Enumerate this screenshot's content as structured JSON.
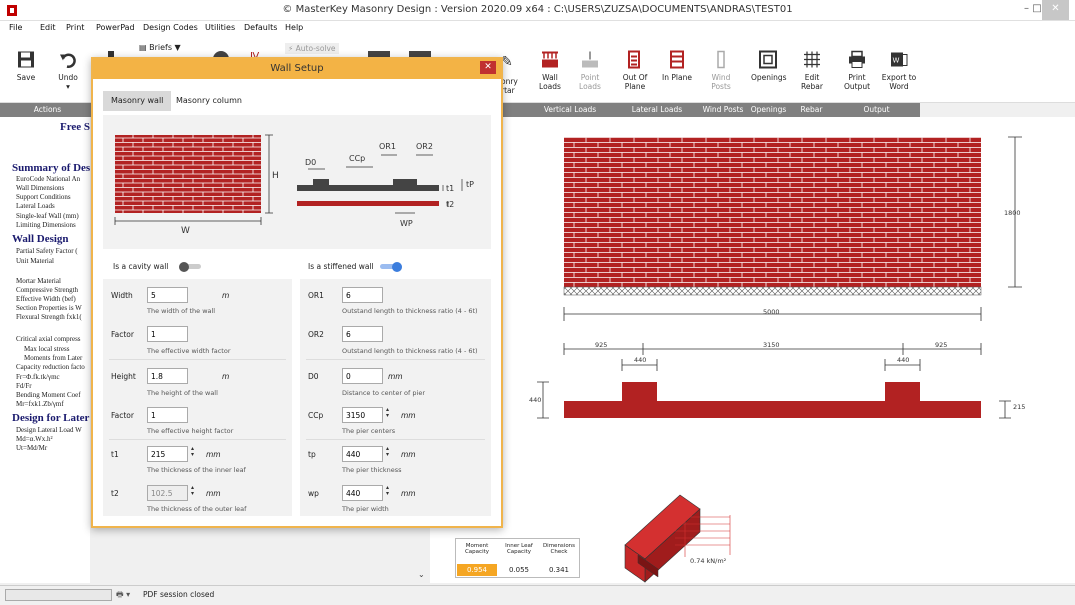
{
  "window": {
    "title": "© MasterKey Masonry Design : Version 2020.09 x64 : C:\\USERS\\ZUZSA\\DOCUMENTS\\ANDRAS\\TEST01"
  },
  "menu": [
    "File",
    "Edit",
    "Print",
    "PowerPad",
    "Design Codes",
    "Utilities",
    "Defaults",
    "Help"
  ],
  "ribbon": {
    "save": "Save",
    "undo": "Undo",
    "briefs": "Briefs",
    "auto_solve": "Auto-solve",
    "wall_loads": "Wall Loads",
    "point_loads": "Point Loads",
    "out_of_plane": "Out Of Plane",
    "in_plane": "In Plane",
    "wind_posts": "Wind Posts",
    "openings": "Openings",
    "edit_rebar": "Edit Rebar",
    "print_output": "Print Output",
    "export_word": "Export to Word",
    "masonry_mortar_partial": "onry\nrtar"
  },
  "groups": [
    "Actions",
    "Vertical Loads",
    "Lateral Loads",
    "Wind Posts",
    "Openings",
    "Rebar",
    "Output"
  ],
  "leftpane": {
    "free": "Free S",
    "summary": "Summary of Des",
    "s1": "EuroCode National An",
    "s2": "Wall Dimensions",
    "s3": "Support Conditions",
    "s4": "Lateral Loads",
    "s5": "Single-leaf Wall (mm)",
    "s6": "Limiting Dimensions",
    "wall_design": "Wall Design",
    "w1": "Partial Safety Factor  (",
    "w2": "Unit Material",
    "w3": "Mortar Material",
    "w4": "Compressive Strength",
    "w5": "Effective Width (bef)",
    "w6": "Section Properties is W",
    "w7": "Flexural Strength  fxk1(",
    "w8": "Critical axial compress",
    "w9": "Max local stress",
    "w10": "Moments from Later",
    "w11": "Capacity reduction facto",
    "w12": "Fr=Φ.fk.tk/γmc",
    "w13": "Fd/Fr",
    "w14": "Bending Moment Coef",
    "w15": "Mr=fxk1.Zb/γmf",
    "design_lat": "Design for Later",
    "d1": "Design Lateral Load W",
    "d2": "Md=α.Wx.h²",
    "d3": "Ut=Md/Mr"
  },
  "dialog": {
    "title": "Wall Setup",
    "close": "✕",
    "tabs": [
      "Masonry wall",
      "Masonry column"
    ],
    "diagram": {
      "H": "H",
      "W": "W",
      "D0": "D0",
      "CCp": "CCp",
      "OR1": "OR1",
      "OR2": "OR2",
      "t1": "t1",
      "t2": "t2",
      "tP": "tP",
      "WP": "WP"
    },
    "cavity_label": "Is a cavity wall",
    "stiffened_label": "Is a stiffened wall",
    "cavity_on": false,
    "stiffened_on": true,
    "left": [
      {
        "label": "Width",
        "value": "5",
        "unit": "m",
        "help": "The width of the wall"
      },
      {
        "label": "Factor",
        "value": "1",
        "unit": "",
        "help": "The effective width factor"
      },
      {
        "label": "Height",
        "value": "1.8",
        "unit": "m",
        "help": "The height of the wall"
      },
      {
        "label": "Factor",
        "value": "1",
        "unit": "",
        "help": "The effective height factor"
      },
      {
        "label": "t1",
        "value": "215",
        "unit": "mm",
        "help": "The thickness of the inner leaf"
      },
      {
        "label": "t2",
        "value": "102.5",
        "unit": "mm",
        "help": "The thickness of the outer leaf"
      }
    ],
    "right": [
      {
        "label": "OR1",
        "value": "6",
        "unit": "",
        "help": "Outstand length to thickness ratio (4 - 6t)"
      },
      {
        "label": "OR2",
        "value": "6",
        "unit": "",
        "help": "Outstand length to thickness ratio (4 - 6t)"
      },
      {
        "label": "D0",
        "value": "0",
        "unit": "mm",
        "help": "Distance to center of pier"
      },
      {
        "label": "CCp",
        "value": "3150",
        "unit": "mm",
        "help": "The pier centers"
      },
      {
        "label": "tp",
        "value": "440",
        "unit": "mm",
        "help": "The pier thickness"
      },
      {
        "label": "wp",
        "value": "440",
        "unit": "mm",
        "help": "The pier width"
      }
    ]
  },
  "drawing": {
    "height_dim": "1800",
    "width_dim": "5000",
    "seg1": "925",
    "seg2": "3150",
    "seg3": "925",
    "pier1": "440",
    "pier2": "440",
    "pier_depth": "440",
    "wall_thk": "215",
    "load": "0.74 kN/m²"
  },
  "results": {
    "headers": [
      "Moment Capacity",
      "Inner Leaf Capacity",
      "Dimensions Check"
    ],
    "values": [
      "0.954",
      "0.055",
      "0.341"
    ],
    "highlight_color": "#f5a623"
  },
  "status": {
    "text": "PDF session closed"
  },
  "colors": {
    "brick": "#b22222",
    "accent": "#3b7ddd",
    "dialog_border": "#f3b345"
  }
}
